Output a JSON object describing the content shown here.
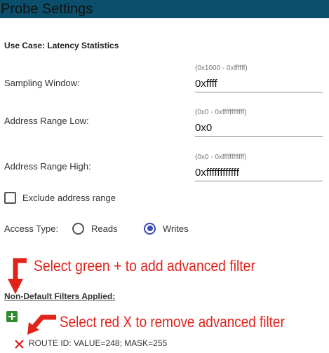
{
  "header": {
    "title": "Probe Settings",
    "bar_color": "#0b4f6c"
  },
  "use_case": {
    "text": "Use Case: Latency Statistics"
  },
  "fields": [
    {
      "label": "Sampling Window:",
      "range": "(0x1000 - 0xffffff)",
      "value": "0xffff"
    },
    {
      "label": "Address Range Low:",
      "range": "(0x0 - 0xffffffffffff)",
      "value": "0x0"
    },
    {
      "label": "Address Range High:",
      "range": "(0x0 - 0xffffffffffff)",
      "value": "0xffffffffffff"
    }
  ],
  "exclude": {
    "label": "Exclude address range",
    "checked": false
  },
  "access_type": {
    "label": "Access Type:",
    "options": [
      {
        "label": "Reads",
        "selected": false
      },
      {
        "label": "Writes",
        "selected": true
      }
    ],
    "accent": "#3a4fb8"
  },
  "annotations": {
    "add_hint": "Select green + to add advanced filter",
    "remove_hint": "Select red X to remove advanced filter",
    "color": "#e2231a"
  },
  "filters": {
    "heading": "Non-Default Filters Applied:",
    "add_icon": "plus-icon",
    "remove_icon": "close-icon",
    "add_color": "#2e8b2e",
    "items": [
      {
        "text": "ROUTE ID: VALUE=248; MASK=255"
      }
    ]
  }
}
